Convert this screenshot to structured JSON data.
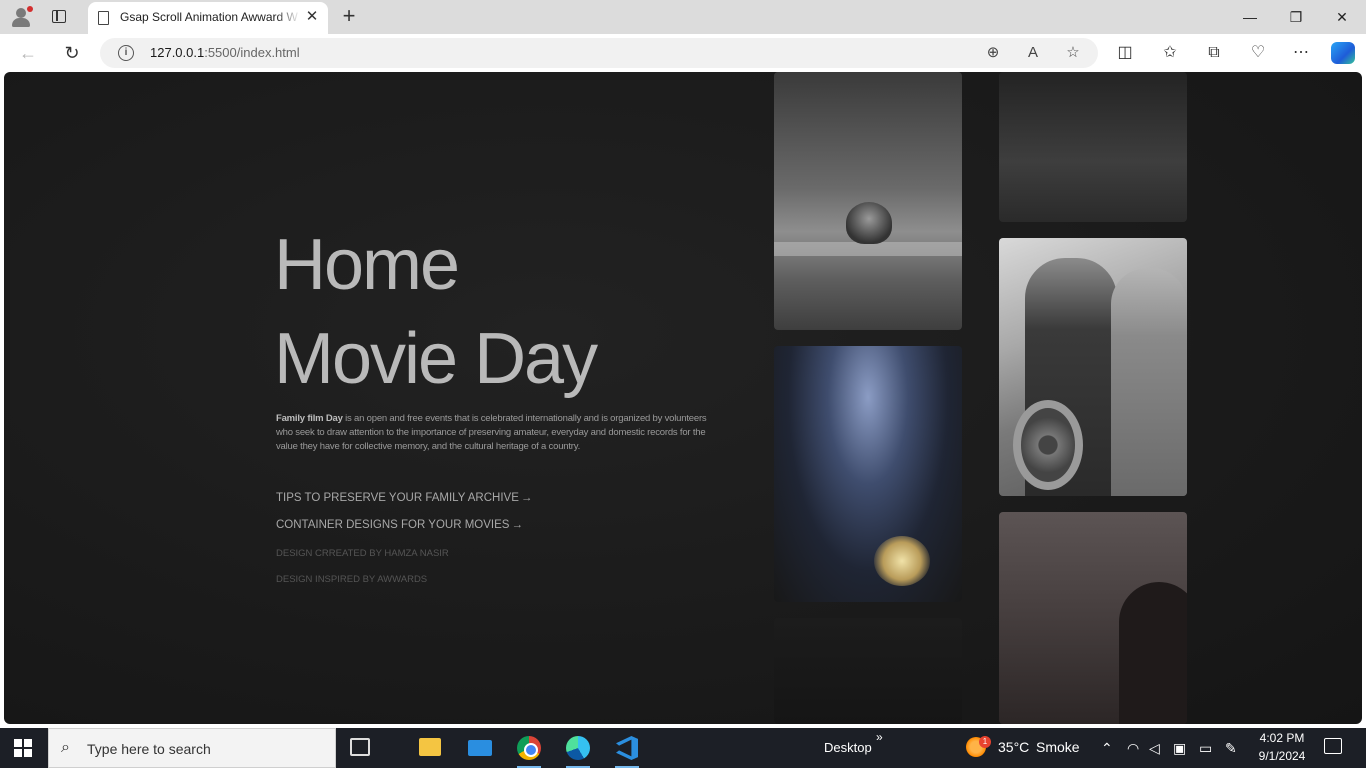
{
  "browser": {
    "tab_title": "Gsap Scroll Animation Awward W",
    "tab_close": "✕",
    "new_tab": "+",
    "url_host": "127.0.0.1",
    "url_path": ":5500/index.html",
    "window": {
      "minimize": "—",
      "restore": "❐",
      "close": "✕"
    },
    "nav": {
      "back": "←",
      "reload": "↻"
    }
  },
  "hero": {
    "title_line1": "Home",
    "title_line2": "Movie Day",
    "description_lead": "Family film Day",
    "description_body": " is an open and free events that is celebrated internationally and is organized by volunteers who seek to draw attention to the importance of preserving amateur, everyday and domestic records for the value they have for collective memory, and the cultural heritage of a country.",
    "links": [
      {
        "label": "TIPS TO PRESERVE YOUR FAMILY ARCHIVE",
        "arrow": "→"
      },
      {
        "label": "CONTAINER DESIGNS FOR YOUR MOVIES",
        "arrow": "→"
      }
    ],
    "credits": [
      "DESIGN CRREATED BY HAMZA NASIR",
      "DESIGN INSPIRED BY AWWARDS"
    ]
  },
  "taskbar": {
    "search_placeholder": "Type here to search",
    "desktop_label": "Desktop",
    "desktop_chevron": "»",
    "weather_badge": "1",
    "temperature": "35°C",
    "weather": "Smoke",
    "time": "4:02 PM",
    "date": "9/1/2024"
  },
  "icons": [
    "profile-icon",
    "tab-actions-icon",
    "page-icon",
    "back-icon",
    "reload-icon",
    "info-icon",
    "zoom-icon",
    "read-aloud-icon",
    "favorite-star-icon",
    "split-screen-icon",
    "favorites-icon",
    "collections-icon",
    "browser-essentials-icon",
    "more-icon",
    "copilot-icon",
    "windows-start-icon",
    "search-icon",
    "task-view-icon",
    "file-explorer-icon",
    "mail-icon",
    "chrome-icon",
    "edge-icon",
    "vscode-icon",
    "weather-icon",
    "chevron-up-icon",
    "network-icon",
    "volume-icon",
    "battery-icon",
    "pen-icon",
    "notifications-icon"
  ]
}
